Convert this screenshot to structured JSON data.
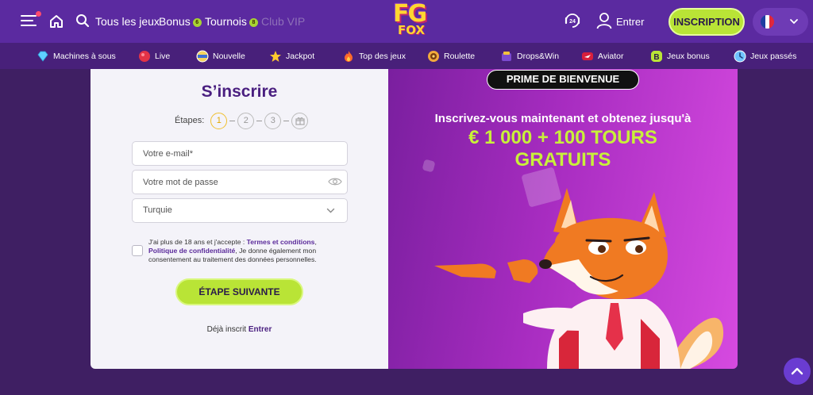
{
  "header": {
    "nav": [
      {
        "label": "Tous les jeux",
        "badge": null,
        "muted": false
      },
      {
        "label": "Bonus",
        "badge": "6",
        "muted": false
      },
      {
        "label": "Tournois",
        "badge": "8",
        "muted": false
      },
      {
        "label": "Club VIP",
        "badge": null,
        "muted": true
      }
    ],
    "logo": {
      "top": "FG",
      "bottom": "FOX"
    },
    "login_label": "Entrer",
    "signup_label": "INSCRIPTION",
    "support_badge": "24",
    "language": "fr",
    "colors": {
      "header_bg": "#5b2aa0",
      "accent_green": "#b9e436",
      "page_bg": "#3f1f63"
    }
  },
  "categories": [
    {
      "label": "Machines à sous",
      "icon": "diamond-icon"
    },
    {
      "label": "Live",
      "icon": "live-icon"
    },
    {
      "label": "Nouvelle",
      "icon": "new-icon"
    },
    {
      "label": "Jackpot",
      "icon": "star-icon"
    },
    {
      "label": "Top des jeux",
      "icon": "fire-icon"
    },
    {
      "label": "Roulette",
      "icon": "roulette-icon"
    },
    {
      "label": "Drops&Win",
      "icon": "drops-win-icon"
    },
    {
      "label": "Aviator",
      "icon": "aviator-icon"
    },
    {
      "label": "Jeux bonus",
      "icon": "bonus-games-icon"
    },
    {
      "label": "Jeux passés",
      "icon": "history-icon"
    }
  ],
  "form": {
    "title": "S’inscrire",
    "steps_label": "Étapes:",
    "steps": [
      "1",
      "2",
      "3"
    ],
    "email_placeholder": "Votre e-mail*",
    "password_placeholder": "Votre mot de passe",
    "country_value": "Turquie",
    "consent": {
      "prefix": "J'ai plus de 18 ans et j'accepte : ",
      "terms_link": "Termes et conditions",
      "comma": ",",
      "privacy_link": "Politique de confidentialité",
      "suffix": ", Je donne également mon consentement au traitement des données personnelles."
    },
    "next_label": "ÉTAPE SUIVANTE",
    "already_prefix": "Déjà inscrit",
    "already_link": "Entrer"
  },
  "promo": {
    "badge": "PRIME DE BIENVENUE",
    "subtitle": "Inscrivez-vous maintenant et obtenez jusqu'à",
    "amount_line1": "€ 1 000 + 100 TOURS",
    "amount_line2": "GRATUITS"
  }
}
